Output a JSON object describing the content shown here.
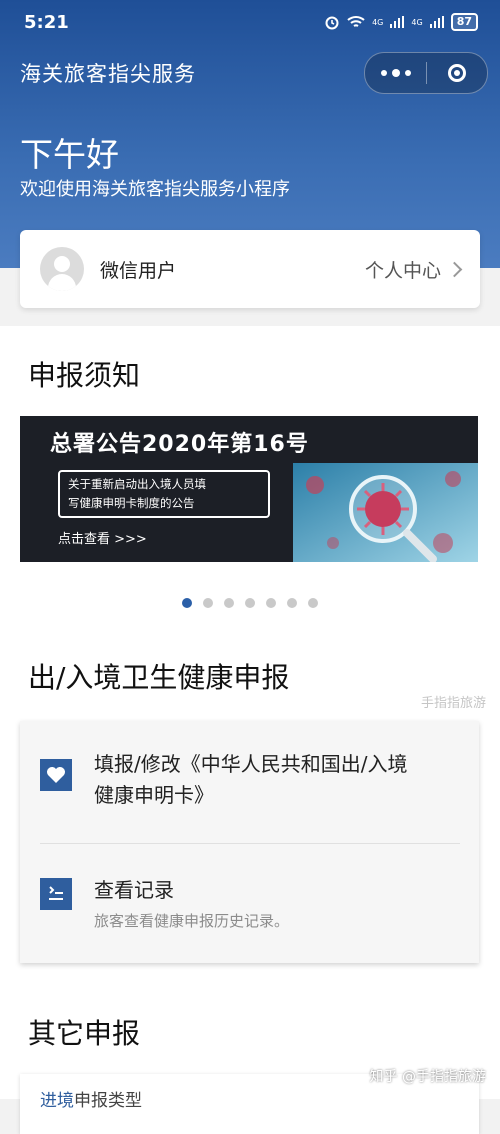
{
  "status_bar": {
    "time": "5:21",
    "signal1": "4G",
    "signal2": "4G",
    "battery": "87"
  },
  "nav": {
    "title": "海关旅客指尖服务"
  },
  "hero": {
    "greeting": "下午好",
    "welcome": "欢迎使用海关旅客指尖服务小程序"
  },
  "user": {
    "name": "微信用户",
    "profile_link": "个人中心"
  },
  "notice": {
    "title": "申报须知",
    "banner": {
      "headline": "总署公告2020年第16号",
      "box_line1": "关于重新启动出入境人员填",
      "box_line2": "写健康申明卡制度的公告",
      "cta": "点击查看 >>>"
    },
    "carousel": {
      "count": 7,
      "active_index": 0
    }
  },
  "health": {
    "title": "出/入境卫生健康申报",
    "watermark": "手指指旅游",
    "items": [
      {
        "line1": "填报/修改《中华人民共和国出/入境",
        "line2": "健康申明卡》",
        "icon": "heart-icon"
      },
      {
        "title": "查看记录",
        "subtitle": "旅客查看健康申报历史记录。",
        "icon": "record-icon"
      }
    ]
  },
  "other": {
    "title": "其它申报",
    "first_item_prefix": "进境",
    "first_item_rest": "申报类型"
  },
  "footer_watermark": "知乎 @手指指旅游",
  "colors": {
    "header_blue": "#1f4f97",
    "accent_blue": "#2f5e9e",
    "dot_active": "#2b5fa8"
  }
}
